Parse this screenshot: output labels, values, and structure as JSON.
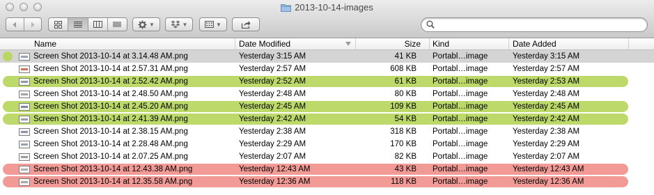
{
  "window": {
    "title": "2013-10-14-images"
  },
  "toolbar": {
    "back_icon": "chevron-left-icon",
    "forward_icon": "chevron-right-icon",
    "view_modes": [
      "icon-view-icon",
      "list-view-icon",
      "column-view-icon",
      "coverflow-view-icon"
    ],
    "selected_view": "list-view-icon",
    "action_icon": "gear-icon",
    "dropbox_icon": "dropbox-icon",
    "arrange_icon": "arrange-icon",
    "share_icon": "share-icon"
  },
  "search": {
    "value": "",
    "placeholder": ""
  },
  "columns": {
    "name": "Name",
    "date_modified": "Date Modified",
    "size": "Size",
    "kind": "Kind",
    "date_added": "Date Added"
  },
  "colors": {
    "green_tag": "#bcd96a",
    "red_tag": "#f19a96",
    "selection": "#d4d4d4"
  },
  "files": [
    {
      "name": "Screen Shot 2013-10-14 at 3.14.48 AM.png",
      "modified": "Yesterday 3:15 AM",
      "size": "41 KB",
      "kind": "Portabl…image",
      "added": "Yesterday 3:15 AM",
      "label": "none",
      "selected": true
    },
    {
      "name": "Screen Shot 2013-10-14 at 2.57.31 AM.png",
      "modified": "Yesterday 2:57 AM",
      "size": "608 KB",
      "kind": "Portabl…image",
      "added": "Yesterday 2:57 AM",
      "label": "none",
      "selected": false
    },
    {
      "name": "Screen Shot 2013-10-14 at 2.52.42 AM.png",
      "modified": "Yesterday 2:52 AM",
      "size": "61 KB",
      "kind": "Portabl…image",
      "added": "Yesterday 2:53 AM",
      "label": "green",
      "selected": false
    },
    {
      "name": "Screen Shot 2013-10-14 at 2.48.50 AM.png",
      "modified": "Yesterday 2:48 AM",
      "size": "80 KB",
      "kind": "Portabl…image",
      "added": "Yesterday 2:48 AM",
      "label": "none",
      "selected": false
    },
    {
      "name": "Screen Shot 2013-10-14 at 2.45.20 AM.png",
      "modified": "Yesterday 2:45 AM",
      "size": "109 KB",
      "kind": "Portabl…image",
      "added": "Yesterday 2:45 AM",
      "label": "green",
      "selected": false
    },
    {
      "name": "Screen Shot 2013-10-14 at 2.41.39 AM.png",
      "modified": "Yesterday 2:42 AM",
      "size": "54 KB",
      "kind": "Portabl…image",
      "added": "Yesterday 2:42 AM",
      "label": "green",
      "selected": false
    },
    {
      "name": "Screen Shot 2013-10-14 at 2.38.15 AM.png",
      "modified": "Yesterday 2:38 AM",
      "size": "318 KB",
      "kind": "Portabl…image",
      "added": "Yesterday 2:38 AM",
      "label": "none",
      "selected": false
    },
    {
      "name": "Screen Shot 2013-10-14 at 2.28.48 AM.png",
      "modified": "Yesterday 2:29 AM",
      "size": "170 KB",
      "kind": "Portabl…image",
      "added": "Yesterday 2:29 AM",
      "label": "none",
      "selected": false
    },
    {
      "name": "Screen Shot 2013-10-14 at 2.07.25 AM.png",
      "modified": "Yesterday 2:07 AM",
      "size": "82 KB",
      "kind": "Portabl…image",
      "added": "Yesterday 2:07 AM",
      "label": "none",
      "selected": false
    },
    {
      "name": "Screen Shot 2013-10-14 at 12.43.38 AM.png",
      "modified": "Yesterday 12:43 AM",
      "size": "43 KB",
      "kind": "Portabl…image",
      "added": "Yesterday 12:43 AM",
      "label": "red",
      "selected": false
    },
    {
      "name": "Screen Shot 2013-10-14 at 12.35.58 AM.png",
      "modified": "Yesterday 12:36 AM",
      "size": "118 KB",
      "kind": "Portabl…image",
      "added": "Yesterday 12:36 AM",
      "label": "red",
      "selected": false
    }
  ]
}
